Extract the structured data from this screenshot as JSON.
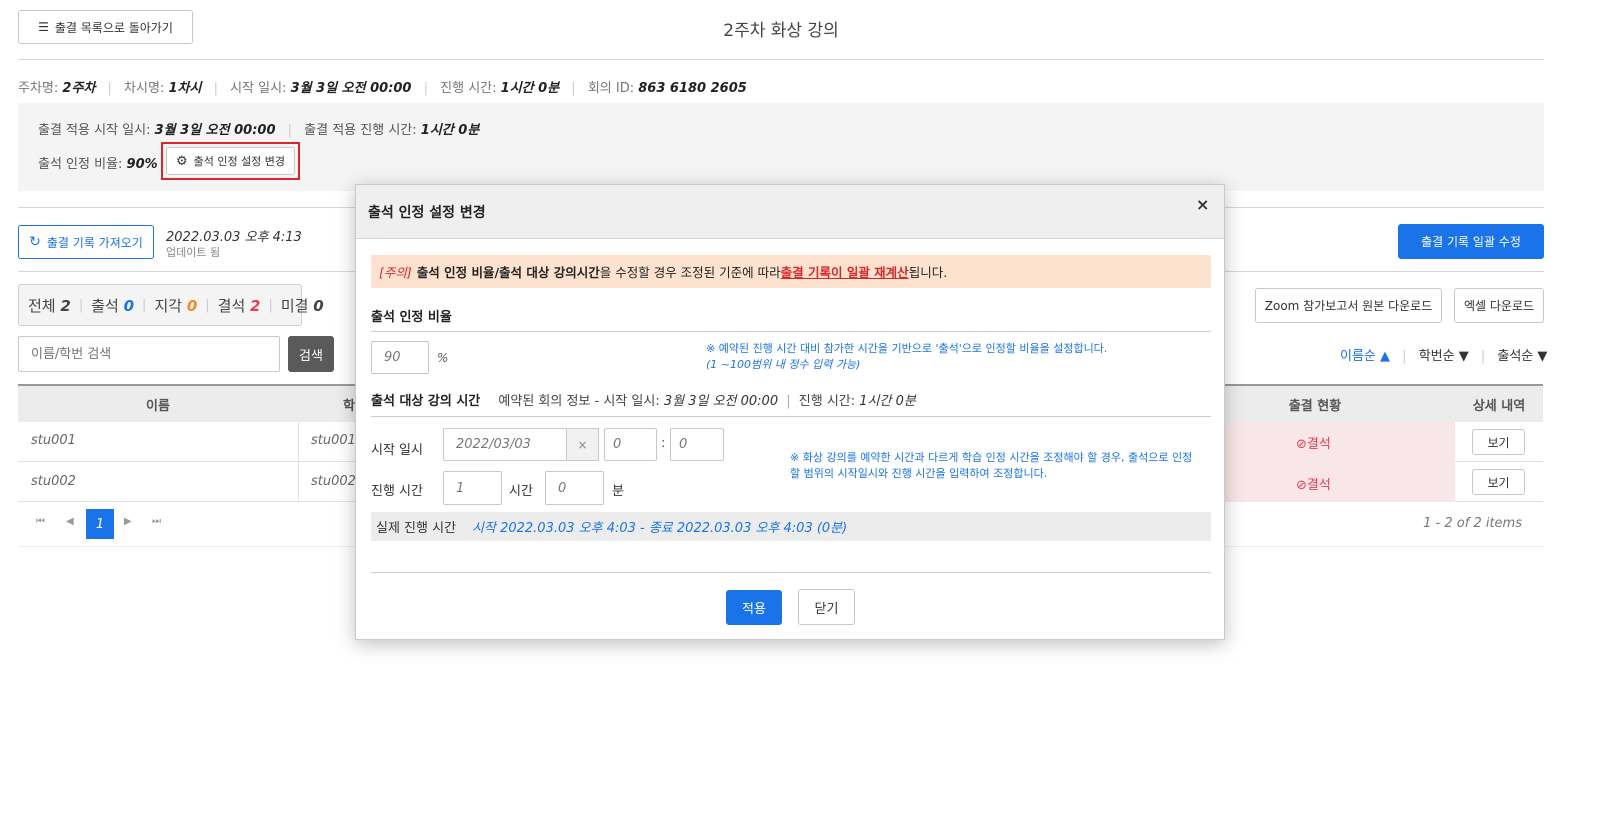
{
  "header": {
    "back_button": "출결 목록으로 돌아가기",
    "title": "2주차 화상 강의"
  },
  "meta": {
    "week_label": "주차명:",
    "week_value": "2주차",
    "session_label": "차시명:",
    "session_value": "1차시",
    "start_label": "시작 일시:",
    "start_value": "3월 3일 오전 00:00",
    "duration_label": "진행 시간:",
    "duration_value": "1시간 0분",
    "meeting_label": "회의 ID:",
    "meeting_value": "863 6180 2605"
  },
  "settings_box": {
    "apply_start_label": "출결 적용 시작 일시:",
    "apply_start_value": "3월 3일 오전 00:00",
    "apply_duration_label": "출결 적용 진행 시간:",
    "apply_duration_value": "1시간 0분",
    "ratio_label": "출석 인정 비율:",
    "ratio_value": "90%",
    "change_button": "출석 인정 설정 변경"
  },
  "toolbar": {
    "fetch_button": "출결 기록 가져오기",
    "updated_time": "2022.03.03 오후 4:13",
    "updated_label": "업데이트 됨",
    "bulk_edit_button": "출결 기록 일괄 수정",
    "zoom_download_button": "Zoom 참가보고서 원본 다운로드",
    "excel_download_button": "엑셀 다운로드"
  },
  "summary": {
    "total_label": "전체",
    "total": "2",
    "present_label": "출석",
    "present": "0",
    "late_label": "지각",
    "late": "0",
    "absent_label": "결석",
    "absent": "2",
    "unchecked_label": "미결",
    "unchecked": "0"
  },
  "search": {
    "placeholder": "이름/학번 검색",
    "button": "검색"
  },
  "sort": {
    "by_name": "이름순 ▲",
    "by_id": "학번순 ▼",
    "by_attendance": "출석순 ▼"
  },
  "table": {
    "columns": [
      "이름",
      "학",
      "출결 현황",
      "상세 내역"
    ],
    "rows": [
      {
        "name": "stu001",
        "id": "stu001",
        "status": "결석",
        "detail": "보기"
      },
      {
        "name": "stu002",
        "id": "stu002",
        "status": "결석",
        "detail": "보기"
      }
    ],
    "pager_current": "1",
    "pager_info": "1 - 2 of 2 items"
  },
  "modal": {
    "title": "출석 인정 설정 변경",
    "close": "×",
    "warning_prefix": "[주의]",
    "warning_bold": "출석 인정 비율/출석 대상 강의시간",
    "warning_mid": "을 수정할 경우 조정된 기준에 따라 ",
    "warning_link": "출결 기록이 일괄 재계산",
    "warning_end": "됩니다.",
    "ratio_section": "출석 인정 비율",
    "ratio_value": "90",
    "ratio_unit": "%",
    "ratio_note_1": "※ 예약된 진행 시간 대비 참가한 시간을 기반으로 '출석'으로 인정할 비율을 설정합니다.",
    "ratio_note_2": "(1 ~100범위 내 정수 입력 가능)",
    "time_section": "출석 대상 강의 시간",
    "reserved_info_prefix": "예약된 회의 정보 - 시작 일시:",
    "reserved_start": "3월 3일 오전 00:00",
    "reserved_duration_label": "진행 시간:",
    "reserved_duration": "1시간 0분",
    "start_label": "시작 일시",
    "start_date": "2022/03/03",
    "start_clear": "×",
    "start_hour": "0",
    "start_colon": ":",
    "start_minute": "0",
    "duration_label": "진행 시간",
    "duration_hours": "1",
    "hours_unit": "시간",
    "duration_minutes": "0",
    "minutes_unit": "분",
    "time_note_1": "※ 화상 강의를 예약한 시간과 다르게 학습 인정 시간을 조정해야 할 경우, 출석으로 인정",
    "time_note_2": "할 범위의 시작일시와 진행 시간을 입력하여 조정합니다.",
    "actual_label": "실제 진행 시간",
    "actual_value": "시작 2022.03.03 오후 4:03 - 종료 2022.03.03 오후 4:03   (0분)",
    "apply_button": "적용",
    "cancel_button": "닫기"
  },
  "colors": {
    "accent": "#1a73e8",
    "danger": "#e04050",
    "warning_bg": "#fde3cf",
    "highlight_border": "#d9262c"
  }
}
